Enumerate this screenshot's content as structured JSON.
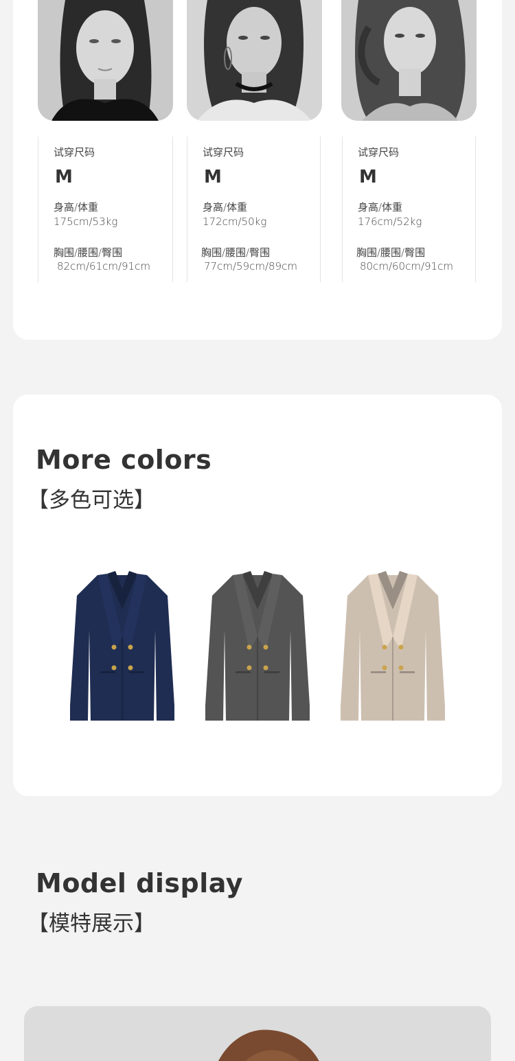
{
  "models": [
    {
      "size_label": "试穿尺码",
      "size": "M",
      "hw_label": "身高/体重",
      "hw": "175cm/53kg",
      "bwh_label": "胸围/腰围/臀围",
      "bwh": "82cm/61cm/91cm"
    },
    {
      "size_label": "试穿尺码",
      "size": "M",
      "hw_label": "身高/体重",
      "hw": "172cm/50kg",
      "bwh_label": "胸围/腰围/臀围",
      "bwh": "77cm/59cm/89cm"
    },
    {
      "size_label": "试穿尺码",
      "size": "M",
      "hw_label": "身高/体重",
      "hw": "176cm/52kg",
      "bwh_label": "胸围/腰围/臀围",
      "bwh": "80cm/60cm/91cm"
    }
  ],
  "colors_section": {
    "title": "More colors",
    "subtitle": "【多色可选】",
    "coats": [
      {
        "name": "navy",
        "color": "#1f2d52"
      },
      {
        "name": "charcoal",
        "color": "#545454"
      },
      {
        "name": "beige",
        "color": "#cdbfb0"
      }
    ]
  },
  "model_section": {
    "title": "Model display",
    "subtitle": "【模特展示】"
  }
}
